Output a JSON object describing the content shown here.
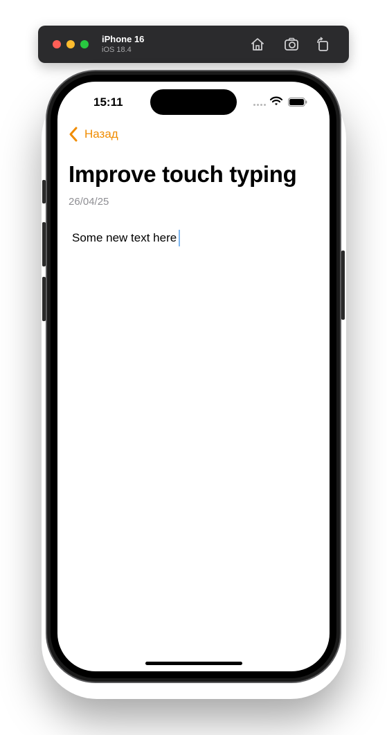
{
  "simulator": {
    "device_name": "iPhone 16",
    "os_version": "iOS 18.4",
    "buttons": {
      "home_icon": "house-icon",
      "screenshot_icon": "camera-icon",
      "rotate_icon": "rotate-icon"
    }
  },
  "status_bar": {
    "time": "15:11",
    "wifi_icon": "wifi-icon",
    "battery_icon": "battery-icon"
  },
  "nav": {
    "back_label": "Назад",
    "back_icon": "chevron-left-icon",
    "accent_color": "#f08c00"
  },
  "note": {
    "title": "Improve touch typing",
    "date": "26/04/25",
    "body": "Some new text here"
  }
}
